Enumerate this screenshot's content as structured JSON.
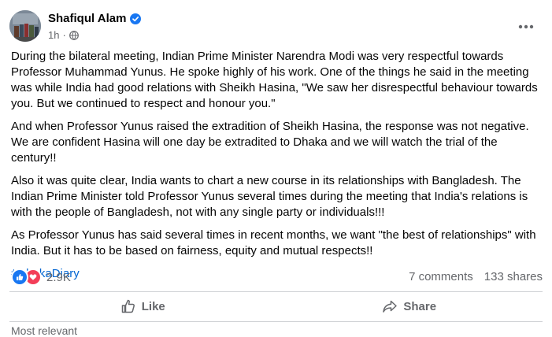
{
  "post": {
    "author": "Shafiqul Alam",
    "time": "1h",
    "dot": "·",
    "paragraphs": [
      "During the bilateral meeting, Indian Prime Minister Narendra Modi was very respectful towards Professor Muhammad Yunus. He spoke highly of his work. One of the things he said in the meeting was while India had good relations with Sheikh Hasina, \"We saw her disrespectful behaviour towards you. But we continued to respect and honour you.\"",
      "And when Professor Yunus raised the extradition of Sheikh Hasina, the response was not negative. We are confident Hasina will one day be extradited to Dhaka and we will watch the trial of the century!!",
      "Also it was quite clear, India wants to chart a new course in its relationships with Bangladesh. The Indian Prime Minister told Professor Yunus several times during the meeting that India's relations is with the people of Bangladesh, not with any single party or individuals!!!",
      "As Professor Yunus has said several times in recent months, we want \"the best of relationships\" with India. But it has to be based on fairness, equity and mutual respects!!"
    ],
    "hashtag": "#DhakaDiary"
  },
  "engagement": {
    "reaction_count": "2.9K",
    "comments": "7 comments",
    "shares": "133 shares"
  },
  "actions": {
    "like": "Like",
    "share": "Share"
  },
  "peek_text": "Most relevant",
  "icons": {
    "verified": "verified-badge-icon",
    "audience": "globe-icon",
    "menu": "more-dots-icon",
    "like": "thumbs-up-icon",
    "share": "share-arrow-icon",
    "reaction_like": "like-reaction-icon",
    "reaction_love": "love-reaction-icon"
  },
  "colors": {
    "link": "#0064d1",
    "like_reaction": "#1877f2",
    "love_reaction": "#f33e58",
    "verified": "#1877f2",
    "secondary_text": "#65676b"
  }
}
